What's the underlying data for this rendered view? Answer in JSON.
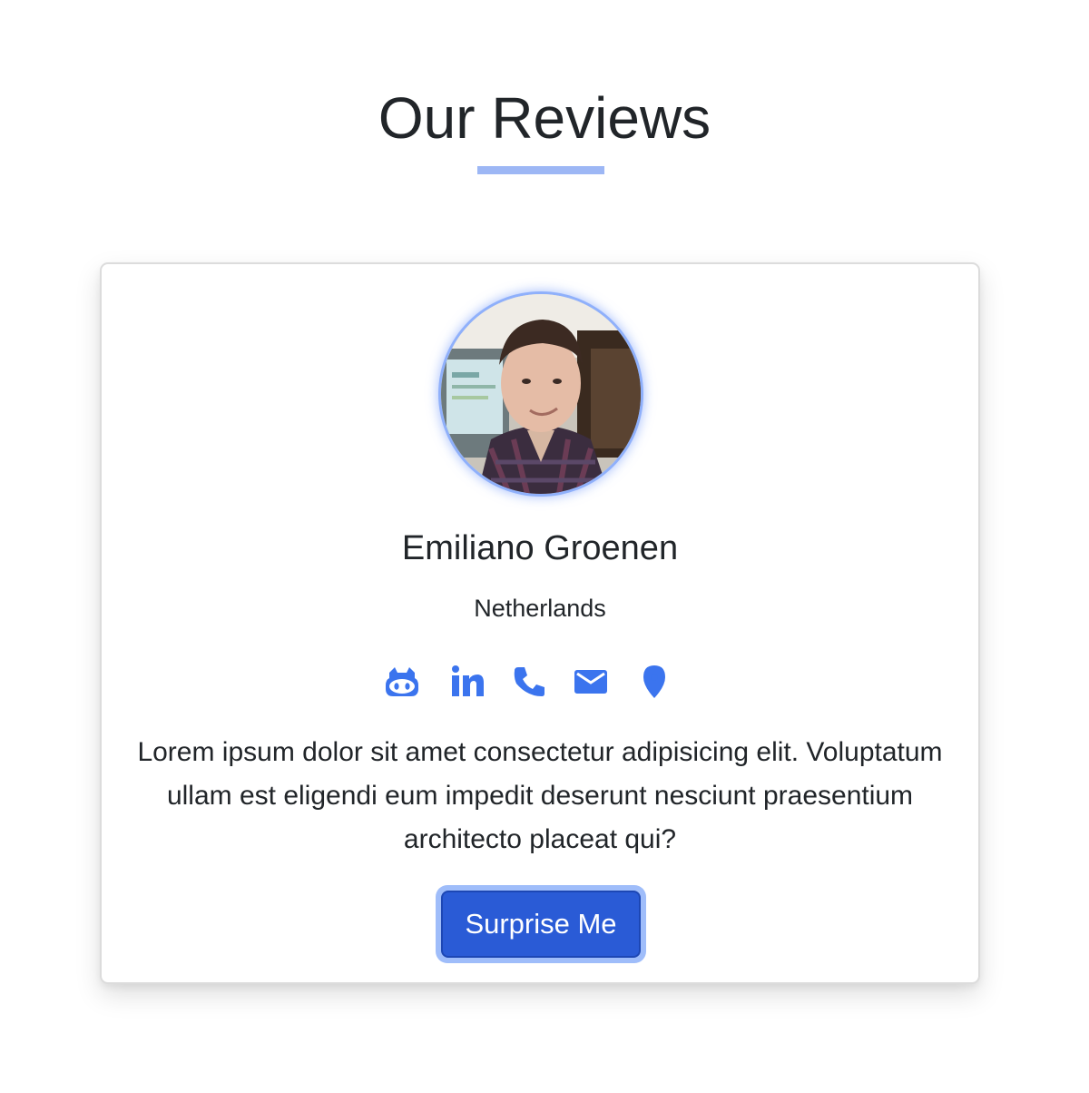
{
  "header": {
    "title": "Our Reviews"
  },
  "review": {
    "name": "Emiliano Groenen",
    "country": "Netherlands",
    "text": "Lorem ipsum dolor sit amet consectetur adipisicing elit. Voluptatum ullam est eligendi eum impedit deserunt nesciunt praesentium architecto placeat qui?",
    "social_icons": [
      "github-icon",
      "linkedin-icon",
      "phone-icon",
      "email-icon",
      "location-icon"
    ],
    "button_label": "Surprise Me"
  },
  "colors": {
    "accent": "#3b74ee",
    "button": "#2a5bd6",
    "underline": "#9db7f5",
    "text": "#212529"
  }
}
